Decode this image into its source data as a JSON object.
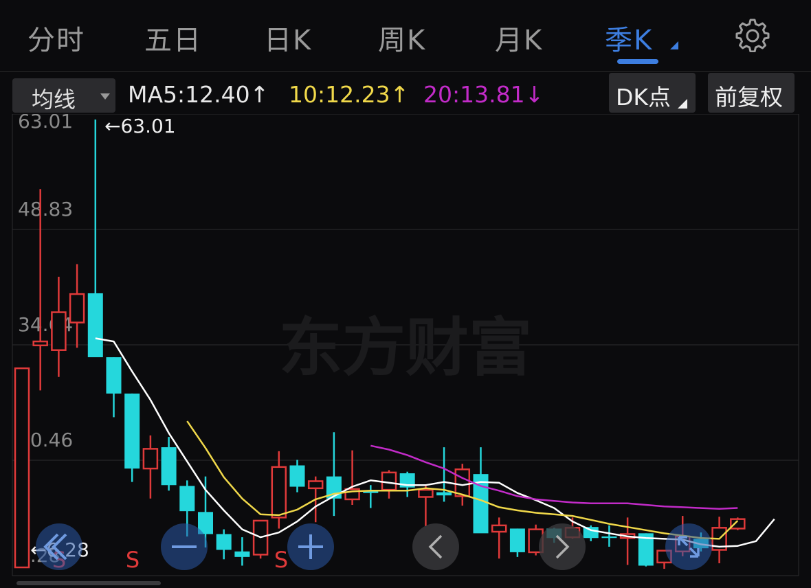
{
  "tabs": [
    {
      "label": "分时",
      "active": false
    },
    {
      "label": "五日",
      "active": false
    },
    {
      "label": "日K",
      "active": false
    },
    {
      "label": "周K",
      "active": false
    },
    {
      "label": "月K",
      "active": false
    },
    {
      "label": "季K",
      "active": true
    }
  ],
  "toolbar": {
    "indicator_select": "均线",
    "ma5": "MA5:12.40↑",
    "ma10": "10:12.23↑",
    "ma20": "20:13.81↓",
    "dk_button": "DK点",
    "adjust_button": "前复权"
  },
  "colors": {
    "up": "#e03a3a",
    "down": "#25d7dc",
    "ma5": "#ffffff",
    "ma10": "#f0d84a",
    "ma20": "#c22bc8",
    "accent": "#3d7ee0"
  },
  "watermark": "东方财富",
  "chart_data": {
    "type": "candlestick",
    "y_ticks": [
      "63.01",
      "48.83",
      "34.64",
      "20.46",
      "6.28"
    ],
    "ylim": [
      6.28,
      63.01
    ],
    "annotations": [
      {
        "text": "←63.01",
        "value": 63.01
      },
      {
        "text": "←6.28",
        "value": 6.28
      }
    ],
    "signals": [
      "S",
      "S",
      "S"
    ],
    "candles": [
      {
        "o": 6.28,
        "h": 31.5,
        "l": 6.28,
        "c": 31.5
      },
      {
        "o": 34.4,
        "h": 54.2,
        "l": 28.7,
        "c": 34.9
      },
      {
        "o": 33.8,
        "h": 43.1,
        "l": 30.4,
        "c": 38.6
      },
      {
        "o": 37.3,
        "h": 44.7,
        "l": 34.1,
        "c": 40.9
      },
      {
        "o": 41.0,
        "h": 63.01,
        "l": 32.9,
        "c": 32.9
      },
      {
        "o": 32.9,
        "h": 32.9,
        "l": 25.3,
        "c": 28.3
      },
      {
        "o": 28.3,
        "h": 28.3,
        "l": 17.1,
        "c": 18.8
      },
      {
        "o": 18.8,
        "h": 23.0,
        "l": 15.0,
        "c": 21.3
      },
      {
        "o": 21.5,
        "h": 22.8,
        "l": 16.0,
        "c": 16.7
      },
      {
        "o": 16.6,
        "h": 17.3,
        "l": 10.2,
        "c": 13.4
      },
      {
        "o": 13.3,
        "h": 17.8,
        "l": 8.8,
        "c": 10.5
      },
      {
        "o": 10.5,
        "h": 11.1,
        "l": 7.3,
        "c": 8.5
      },
      {
        "o": 8.3,
        "h": 10.1,
        "l": 6.5,
        "c": 7.6
      },
      {
        "o": 7.9,
        "h": 12.2,
        "l": 7.4,
        "c": 12.2
      },
      {
        "o": 12.6,
        "h": 21.0,
        "l": 11.2,
        "c": 19.0
      },
      {
        "o": 19.2,
        "h": 19.9,
        "l": 15.8,
        "c": 16.5
      },
      {
        "o": 16.3,
        "h": 17.8,
        "l": 12.0,
        "c": 17.2
      },
      {
        "o": 17.8,
        "h": 23.4,
        "l": 12.8,
        "c": 15.0
      },
      {
        "o": 14.9,
        "h": 21.1,
        "l": 14.2,
        "c": 16.2
      },
      {
        "o": 16.0,
        "h": 16.7,
        "l": 13.8,
        "c": 15.7
      },
      {
        "o": 16.1,
        "h": 18.6,
        "l": 15.0,
        "c": 18.3
      },
      {
        "o": 18.2,
        "h": 18.4,
        "l": 15.2,
        "c": 16.4
      },
      {
        "o": 15.2,
        "h": 16.8,
        "l": 11.5,
        "c": 16.1
      },
      {
        "o": 15.8,
        "h": 21.5,
        "l": 14.6,
        "c": 15.4
      },
      {
        "o": 15.3,
        "h": 19.4,
        "l": 14.1,
        "c": 18.7
      },
      {
        "o": 18.1,
        "h": 21.5,
        "l": 10.9,
        "c": 10.6
      },
      {
        "o": 10.8,
        "h": 12.6,
        "l": 7.4,
        "c": 11.6
      },
      {
        "o": 11.2,
        "h": 11.2,
        "l": 7.6,
        "c": 8.2
      },
      {
        "o": 8.2,
        "h": 11.7,
        "l": 7.8,
        "c": 11.1
      },
      {
        "o": 11.2,
        "h": 11.3,
        "l": 9.4,
        "c": 10.0
      },
      {
        "o": 10.1,
        "h": 12.6,
        "l": 9.9,
        "c": 11.3
      },
      {
        "o": 11.4,
        "h": 11.6,
        "l": 9.6,
        "c": 10.0
      },
      {
        "o": 10.2,
        "h": 11.6,
        "l": 8.9,
        "c": 10.0
      },
      {
        "o": 10.0,
        "h": 12.6,
        "l": 6.6,
        "c": 10.5
      },
      {
        "o": 10.6,
        "h": 10.6,
        "l": 6.4,
        "c": 6.5
      },
      {
        "o": 6.9,
        "h": 8.0,
        "l": 6.1,
        "c": 8.4
      },
      {
        "o": 8.3,
        "h": 12.8,
        "l": 7.7,
        "c": 10.2
      },
      {
        "o": 9.9,
        "h": 10.7,
        "l": 8.3,
        "c": 8.7
      },
      {
        "o": 8.5,
        "h": 12.7,
        "l": 6.8,
        "c": 11.3
      },
      {
        "o": 11.2,
        "h": 12.6,
        "l": 11.0,
        "c": 12.4
      }
    ],
    "series": [
      {
        "name": "MA5",
        "start": 4,
        "values": [
          35.3,
          34.9,
          31.1,
          27.5,
          23.3,
          19.7,
          16.1,
          13.5,
          11.1,
          10.1,
          10.7,
          12.1,
          14.0,
          15.3,
          16.5,
          17.3,
          17.0,
          16.7,
          16.7,
          17.1,
          16.7,
          17.1,
          17.0,
          15.7,
          14.8,
          13.8,
          12.1,
          11.0,
          10.6,
          10.2,
          10.0,
          9.9,
          9.8,
          9.2,
          8.9,
          9.0,
          9.6,
          12.4
        ]
      },
      {
        "name": "MA10",
        "start": 9,
        "values": [
          24.8,
          21.4,
          17.7,
          15.0,
          13.0,
          12.9,
          13.6,
          14.9,
          15.6,
          15.9,
          16.0,
          16.0,
          16.0,
          16.3,
          16.1,
          15.5,
          14.8,
          13.9,
          13.5,
          13.2,
          13.0,
          12.8,
          12.3,
          11.8,
          11.4,
          11.0,
          10.6,
          10.3,
          10.0,
          9.9,
          12.2
        ]
      },
      {
        "name": "MA20",
        "start": 19,
        "values": [
          21.7,
          21.2,
          20.5,
          19.6,
          18.8,
          17.6,
          16.6,
          16.0,
          15.3,
          14.9,
          14.7,
          14.5,
          14.4,
          14.4,
          14.4,
          14.2,
          14.0,
          13.9,
          13.8,
          13.7,
          13.81
        ]
      }
    ]
  }
}
